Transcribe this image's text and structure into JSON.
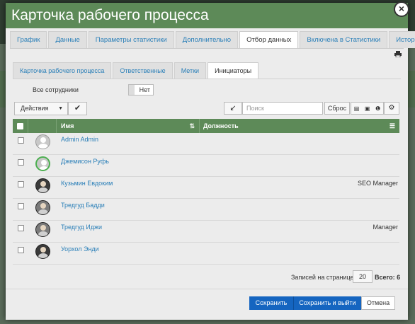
{
  "window": {
    "title": "Карточка рабочего процесса"
  },
  "tabs": [
    {
      "label": "График"
    },
    {
      "label": "Данные"
    },
    {
      "label": "Параметры статистики"
    },
    {
      "label": "Дополнительно"
    },
    {
      "label": "Отбор данных",
      "active": true
    },
    {
      "label": "Включена в Статистики"
    },
    {
      "label": "История"
    }
  ],
  "subtabs": [
    {
      "label": "Карточка рабочего процесса"
    },
    {
      "label": "Ответственные"
    },
    {
      "label": "Метки"
    },
    {
      "label": "Инициаторы",
      "active": true
    }
  ],
  "filter": {
    "all_employees_label": "Все сотрудники",
    "toggle_value": "Нет"
  },
  "toolbar": {
    "actions_label": "Действия",
    "search_placeholder": "Поиск",
    "reset_label": "Сброс"
  },
  "table": {
    "columns": [
      "Имя",
      "Должность"
    ],
    "rows": [
      {
        "name": "Admin Admin",
        "position": "",
        "avatar": "placeholder"
      },
      {
        "name": "Джемисон Руфь",
        "position": "",
        "avatar": "placeholder-green"
      },
      {
        "name": "Кузьмин Евдоким",
        "position": "SEO Manager",
        "avatar": "photo"
      },
      {
        "name": "Тредгуд Бадди",
        "position": "",
        "avatar": "photo"
      },
      {
        "name": "Тредгуд Иджи",
        "position": "Manager",
        "avatar": "photo"
      },
      {
        "name": "Уорхол Энди",
        "position": "",
        "avatar": "photo"
      }
    ]
  },
  "pager": {
    "per_page_label": "Записей на странице",
    "per_page": "20",
    "total": "Всего: 6"
  },
  "footer": {
    "save": "Сохранить",
    "save_exit": "Сохранить и выйти",
    "cancel": "Отмена"
  },
  "colors": {
    "header_green": "#5d8a58",
    "primary_blue": "#1565c0",
    "link_blue": "#2a7fb8"
  }
}
